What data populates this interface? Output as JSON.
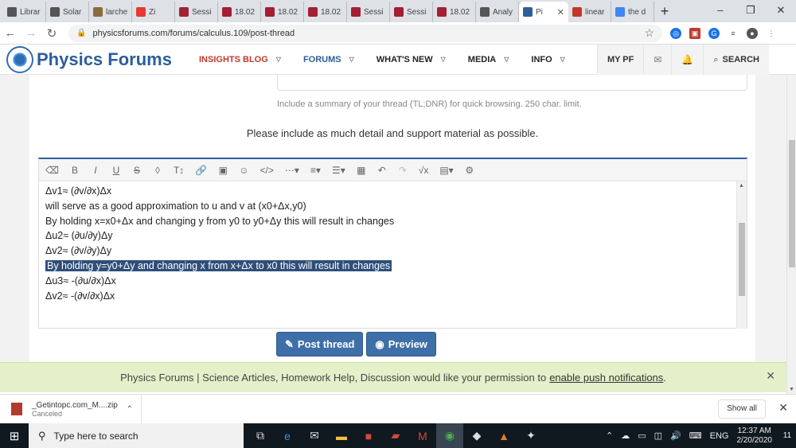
{
  "browser": {
    "tabs": [
      {
        "label": "Librar",
        "color": "#555555"
      },
      {
        "label": "Solar",
        "color": "#555555"
      },
      {
        "label": "larche",
        "color": "#8a6d3b"
      },
      {
        "label": "Zi",
        "color": "#e53935"
      },
      {
        "label": "Sessi",
        "color": "#a31f34"
      },
      {
        "label": "18.02",
        "color": "#a31f34"
      },
      {
        "label": "18.02",
        "color": "#a31f34"
      },
      {
        "label": "18.02",
        "color": "#a31f34"
      },
      {
        "label": "Sessi",
        "color": "#a31f34"
      },
      {
        "label": "Sessi",
        "color": "#a31f34"
      },
      {
        "label": "18.02",
        "color": "#a31f34"
      },
      {
        "label": "Analy",
        "color": "#555555"
      },
      {
        "label": "Pi",
        "color": "#2f5f9a",
        "active": true
      },
      {
        "label": "linear",
        "color": "#c0392b"
      },
      {
        "label": "the d",
        "color": "#4285f4"
      }
    ],
    "new_tab": "+",
    "url": "physicsforums.com/forums/calculus.109/post-thread"
  },
  "site": {
    "logo_text": "Physics Forums",
    "nav": [
      {
        "label": "INSIGHTS BLOG"
      },
      {
        "label": "FORUMS"
      },
      {
        "label": "WHAT'S NEW"
      },
      {
        "label": "MEDIA"
      },
      {
        "label": "INFO"
      }
    ],
    "my_pf": "MY PF",
    "search": "SEARCH"
  },
  "form": {
    "summary_hint": "Include a summary of your thread (TL;DNR) for quick browsing. 250 char. limit.",
    "detail_note": "Please include as much detail and support material as possible.",
    "editor_lines": [
      "Δv1≈ (∂v/∂x)Δx",
      "will serve as a good approximation to u and v at (x0+Δx,y0)",
      "By holding x=x0+Δx and changing y from y0 to y0+Δy this will result in changes",
      "Δu2≈ (∂u/∂y)Δy",
      "Δv2≈ (∂v/∂y)Δy",
      "By holding y=y0+Δy and changing x from x+Δx to x0 this will result in changes",
      "Δu3≈ -(∂u/∂x)Δx",
      "Δv2≈ -(∂v/∂x)Δx"
    ],
    "highlighted_line_index": 5,
    "post_button": "Post thread",
    "preview_button": "Preview"
  },
  "notification": {
    "text": "Physics Forums | Science Articles, Homework Help, Discussion would like your permission to",
    "link": "enable push notifications",
    "suffix": "."
  },
  "downloads": {
    "filename": "_Getintopc.com_M....zip",
    "status": "Canceled",
    "show_all": "Show all"
  },
  "taskbar": {
    "search_placeholder": "Type here to search",
    "language": "ENG",
    "time": "12:37 AM",
    "date": "2/20/2020",
    "notification_count": "11"
  }
}
